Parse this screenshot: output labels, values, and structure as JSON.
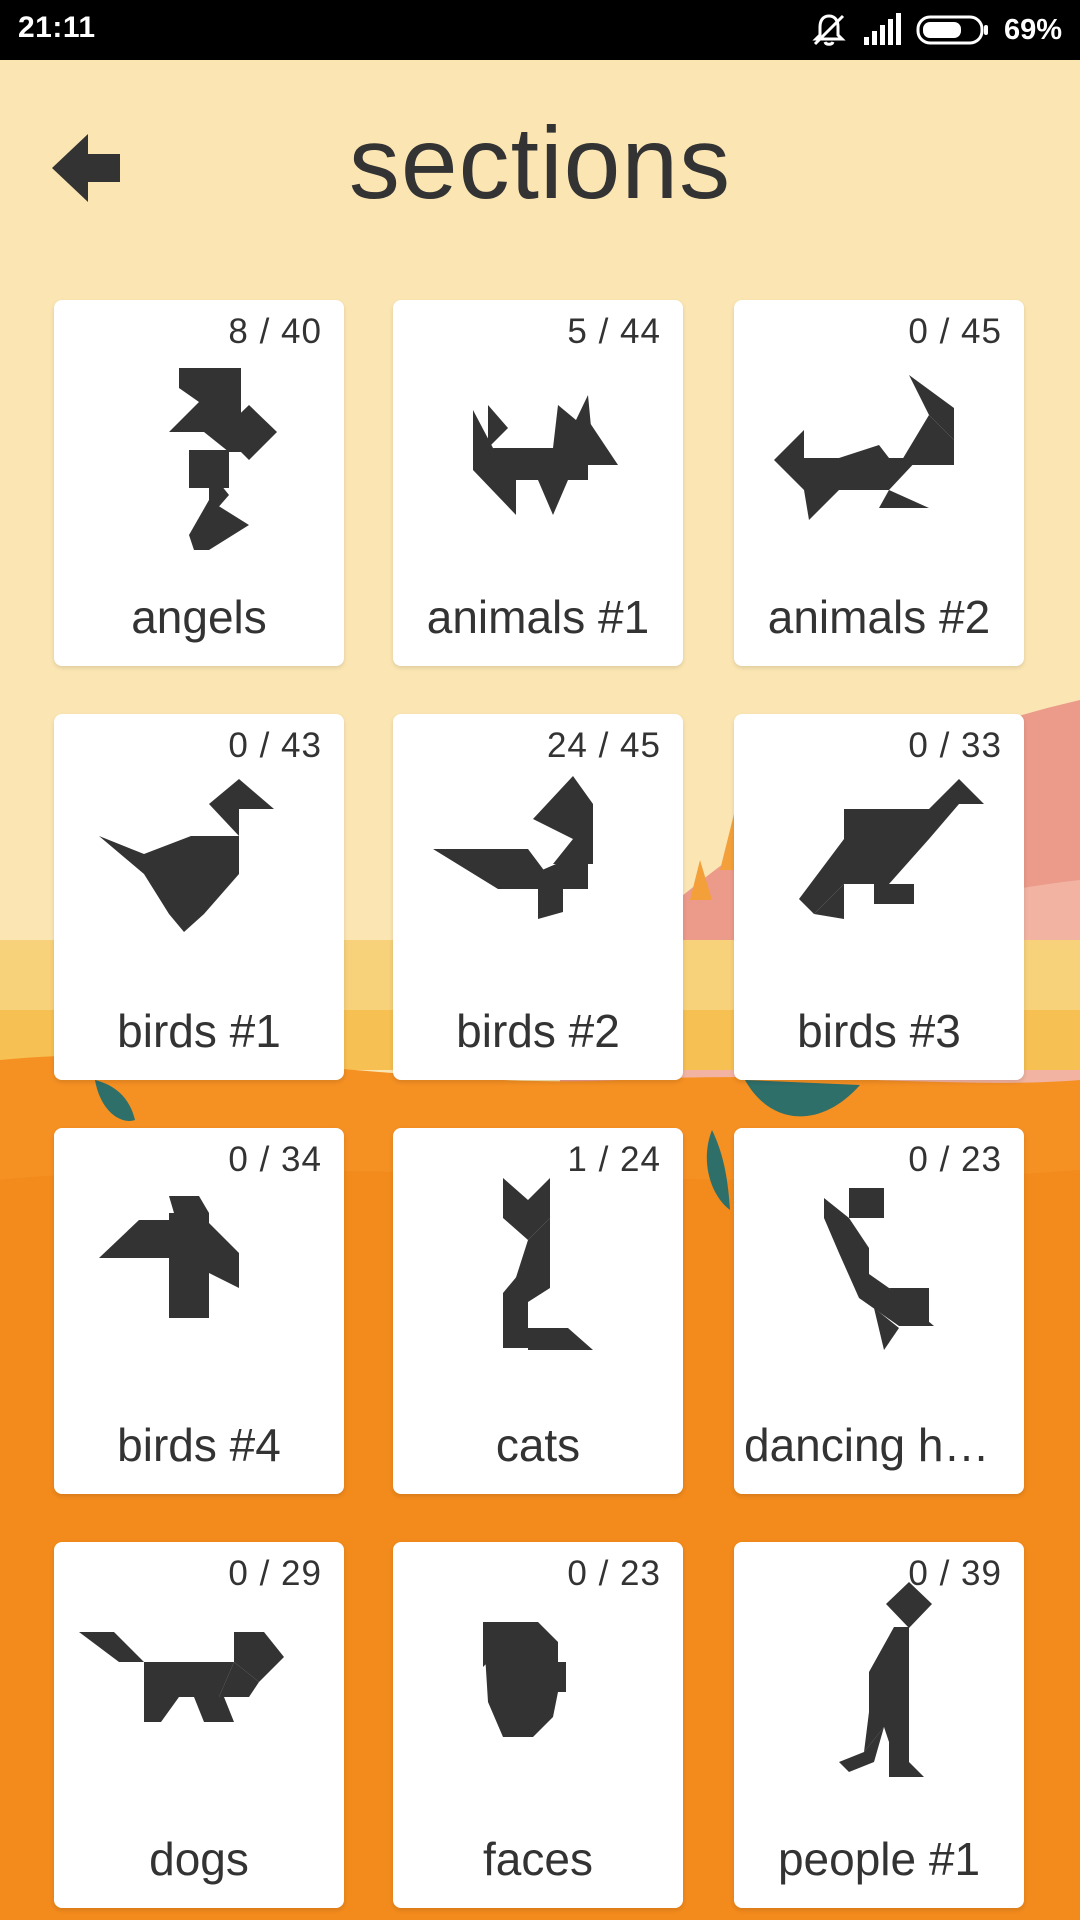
{
  "status_bar": {
    "time": "21:11",
    "battery_percent": "69%",
    "icons": [
      "silent-bell-icon",
      "signal-icon",
      "battery-icon"
    ]
  },
  "header": {
    "title": "sections",
    "back_icon": "back-arrow-icon"
  },
  "colors": {
    "sky": "#fbe6b3",
    "ground": "#f59023",
    "hill_pink": "#ec9a8a",
    "card": "#ffffff",
    "text": "#333333",
    "silhouette": "#333333"
  },
  "sections": [
    {
      "label": "angels",
      "count": "8 / 40",
      "icon": "angel-silhouette-icon"
    },
    {
      "label": "animals #1",
      "count": "5 / 44",
      "icon": "cat-animal-silhouette-icon"
    },
    {
      "label": "animals #2",
      "count": "0 / 45",
      "icon": "goat-animal-silhouette-icon"
    },
    {
      "label": "birds #1",
      "count": "0 / 43",
      "icon": "duck-bird-silhouette-icon"
    },
    {
      "label": "birds #2",
      "count": "24 / 45",
      "icon": "swan-bird-silhouette-icon"
    },
    {
      "label": "birds #3",
      "count": "0 / 33",
      "icon": "crane-bird-silhouette-icon"
    },
    {
      "label": "birds #4",
      "count": "0 / 34",
      "icon": "parrot-bird-silhouette-icon"
    },
    {
      "label": "cats",
      "count": "1 / 24",
      "icon": "cat-silhouette-icon"
    },
    {
      "label": "dancing hu…",
      "count": "0 / 23",
      "icon": "dancing-human-silhouette-icon"
    },
    {
      "label": "dogs",
      "count": "0 / 29",
      "icon": "dog-silhouette-icon"
    },
    {
      "label": "faces",
      "count": "0 / 23",
      "icon": "face-silhouette-icon"
    },
    {
      "label": "people #1",
      "count": "0 / 39",
      "icon": "person-silhouette-icon"
    }
  ]
}
